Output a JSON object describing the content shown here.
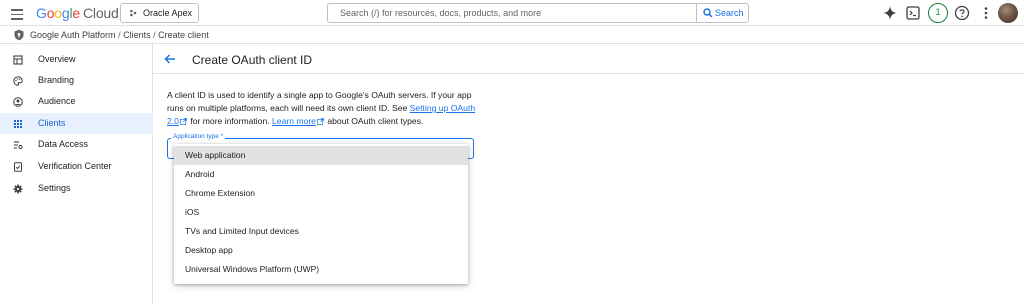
{
  "topbar": {
    "logo": {
      "letters": [
        "G",
        "o",
        "o",
        "g",
        "l",
        "e"
      ],
      "product": "Cloud"
    },
    "project": "Oracle Apex",
    "search": {
      "placeholder": "Search (/) for resources, docs, products, and more",
      "button": "Search"
    },
    "notification_count": "1",
    "icons": [
      "menu-icon",
      "gemini-spark-icon",
      "cloud-shell-icon",
      "help-icon",
      "more-vert-icon"
    ]
  },
  "breadcrumb": [
    "Google Auth Platform",
    "Clients",
    "Create client"
  ],
  "breadcrumb_separator": "/",
  "sidebar": {
    "items": [
      {
        "label": "Overview",
        "icon": "dashboard-icon"
      },
      {
        "label": "Branding",
        "icon": "palette-icon"
      },
      {
        "label": "Audience",
        "icon": "person-icon"
      },
      {
        "label": "Clients",
        "icon": "clients-grid-icon",
        "active": true
      },
      {
        "label": "Data Access",
        "icon": "data-access-icon"
      },
      {
        "label": "Verification Center",
        "icon": "verified-icon"
      },
      {
        "label": "Settings",
        "icon": "settings-icon"
      }
    ]
  },
  "main": {
    "title": "Create OAuth client ID",
    "description": {
      "part1": "A client ID is used to identify a single app to Google's OAuth servers. If your app runs on multiple platforms, each will need its own client ID. See ",
      "link1": "Setting up OAuth 2.0",
      "part2": " for more information. ",
      "link2": "Learn more",
      "part3": " about OAuth client types."
    },
    "application_type": {
      "label": "Application type *",
      "options": [
        "Web application",
        "Android",
        "Chrome Extension",
        "iOS",
        "TVs and Limited Input devices",
        "Desktop app",
        "Universal Windows Platform (UWP)"
      ],
      "highlighted": "Web application"
    }
  },
  "colors": {
    "accent": "#1a73e8",
    "active_nav_bg": "#e8f0fe",
    "option_highlight": "#e2e2e2",
    "badge_green": "#188038"
  }
}
